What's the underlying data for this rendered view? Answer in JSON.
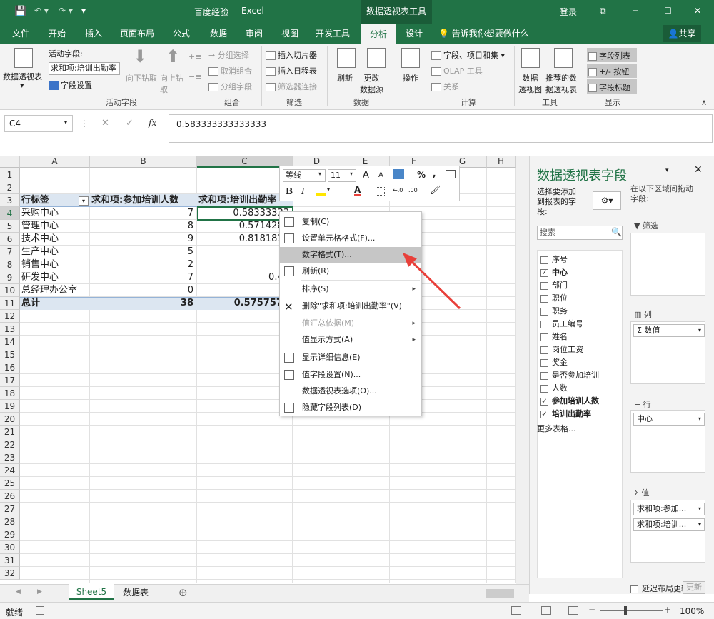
{
  "title": {
    "save_icon": "save-icon",
    "doc_name": "百度经验",
    "sep": "-",
    "app": "Excel",
    "contextual_tab": "数据透视表工具",
    "login": "登录",
    "win_min": "─",
    "win_max": "☐",
    "win_close": "✕"
  },
  "tabs": [
    "文件",
    "开始",
    "插入",
    "页面布局",
    "公式",
    "数据",
    "审阅",
    "视图",
    "开发工具",
    "分析",
    "设计"
  ],
  "tellme": "告诉我你想要做什么",
  "share": "共享",
  "ribbon": {
    "pivot_table": "数据透视表",
    "active_field_label": "活动字段:",
    "active_field_value": "求和项:培训出勤率",
    "field_settings": "字段设置",
    "drill_down": "向下钻取",
    "drill_up": "向上钻取",
    "group_active_field": "活动字段",
    "group_selection": "→ 分组选择",
    "ungroup": "取消组合",
    "group_field": "分组字段",
    "group_group": "组合",
    "insert_slicer": "插入切片器",
    "insert_timeline": "插入日程表",
    "filter_connections": "筛选器连接",
    "group_filter": "筛选",
    "refresh": "刷新",
    "change_source": "更改\n数据源",
    "group_data": "数据",
    "actions": "操作",
    "fields_items_sets": "字段、项目和集",
    "olap_tools": "OLAP 工具",
    "relationships": "关系",
    "group_calc": "计算",
    "pivot_chart": "数据\n透视图",
    "recommended": "推荐的数\n据透视表",
    "group_tools": "工具",
    "field_list": "字段列表",
    "plus_minus": "+/- 按钮",
    "field_headers": "字段标题",
    "group_show": "显示"
  },
  "formula_bar": {
    "name_box": "C4",
    "cancel": "✕",
    "enter": "✓",
    "fx": "fx",
    "value": "0.583333333333333"
  },
  "columns": [
    "A",
    "B",
    "C",
    "D",
    "E",
    "F",
    "G",
    "H"
  ],
  "rows": [
    "1",
    "2",
    "3",
    "4",
    "5",
    "6",
    "7",
    "8",
    "9",
    "10",
    "11",
    "12",
    "13",
    "14",
    "15",
    "16",
    "17",
    "18",
    "19",
    "20",
    "21",
    "22",
    "23",
    "24",
    "25",
    "26",
    "27",
    "28",
    "29",
    "30",
    "31",
    "32"
  ],
  "pivot": {
    "header_a": "行标签",
    "header_b": "求和项:参加培训人数",
    "header_c": "求和项:培训出勤率",
    "data": [
      {
        "label": "采购中心",
        "count": "7",
        "rate": "0.58333333"
      },
      {
        "label": "管理中心",
        "count": "8",
        "rate": "0.5714285"
      },
      {
        "label": "技术中心",
        "count": "9",
        "rate": "0.8181818"
      },
      {
        "label": "生产中心",
        "count": "5",
        "rate": "0"
      },
      {
        "label": "销售中心",
        "count": "2",
        "rate": ""
      },
      {
        "label": "研发中心",
        "count": "7",
        "rate": "0.43"
      },
      {
        "label": "总经理办公室",
        "count": "0",
        "rate": ""
      }
    ],
    "total_label": "总计",
    "total_count": "38",
    "total_rate": "0.5757575"
  },
  "minibar": {
    "font": "等线",
    "size": "11",
    "grow": "A",
    "shrink": "A",
    "bold": "B",
    "italic": "I",
    "percent": "%",
    "comma": ",",
    "font_color": "A",
    "dec_inc": "←.0",
    "dec_dec": ".00"
  },
  "context_menu": [
    {
      "label": "复制(C)",
      "state": "normal"
    },
    {
      "label": "设置单元格格式(F)...",
      "state": "normal"
    },
    {
      "label": "数字格式(T)...",
      "state": "highlight"
    },
    {
      "label": "刷新(R)",
      "state": "normal"
    },
    {
      "label": "排序(S)",
      "state": "normal",
      "sub": "▸"
    },
    {
      "label": "删除\"求和项:培训出勤率\"(V)",
      "state": "normal"
    },
    {
      "label": "值汇总依据(M)",
      "state": "disabled",
      "sub": "▸"
    },
    {
      "label": "值显示方式(A)",
      "state": "normal",
      "sub": "▸"
    },
    {
      "label": "显示详细信息(E)",
      "state": "normal"
    },
    {
      "label": "值字段设置(N)...",
      "state": "normal"
    },
    {
      "label": "数据透视表选项(O)...",
      "state": "normal"
    },
    {
      "label": "隐藏字段列表(D)",
      "state": "normal"
    }
  ],
  "field_pane": {
    "title": "数据透视表字段",
    "choose": "选择要添加\n到报表的字\n段:",
    "drag": "在以下区域间拖动\n字段:",
    "search_placeholder": "搜索",
    "fields": [
      {
        "name": "序号",
        "checked": false
      },
      {
        "name": "中心",
        "checked": true
      },
      {
        "name": "部门",
        "checked": false
      },
      {
        "name": "职位",
        "checked": false
      },
      {
        "name": "职务",
        "checked": false
      },
      {
        "name": "员工编号",
        "checked": false
      },
      {
        "name": "姓名",
        "checked": false
      },
      {
        "name": "岗位工资",
        "checked": false
      },
      {
        "name": "奖金",
        "checked": false
      },
      {
        "name": "是否参加培训",
        "checked": false
      },
      {
        "name": "人数",
        "checked": false
      },
      {
        "name": "参加培训人数",
        "checked": true
      },
      {
        "name": "培训出勤率",
        "checked": true
      }
    ],
    "more_tables": "更多表格...",
    "filters": "筛选",
    "columns": "列",
    "columns_chip": "Σ 数值",
    "rows": "行",
    "rows_chip": "中心",
    "values": "Σ 值",
    "values_chip1": "求和项:参加...",
    "values_chip2": "求和项:培训...",
    "defer": "延迟布局更新",
    "update": "更新"
  },
  "sheets": [
    "Sheet5",
    "数据表"
  ],
  "add_sheet": "⊕",
  "status": {
    "ready": "就绪",
    "zoom": "100%",
    "minus": "−",
    "plus": "+"
  },
  "colors": {
    "excel_green": "#217346",
    "highlight": "#c6c6c6",
    "arrow_red": "#e8403a",
    "pivot_header": "#dce6f1"
  }
}
